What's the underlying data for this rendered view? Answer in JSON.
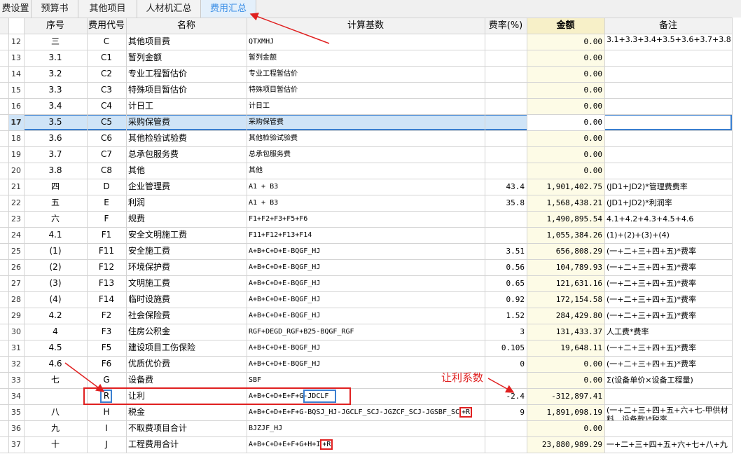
{
  "tabs": [
    {
      "label": "费设置",
      "active": false
    },
    {
      "label": "预算书",
      "active": false
    },
    {
      "label": "其他项目",
      "active": false
    },
    {
      "label": "人材机汇总",
      "active": false
    },
    {
      "label": "费用汇总",
      "active": true
    }
  ],
  "columns": {
    "seq": "序号",
    "code": "费用代号",
    "name": "名称",
    "basis": "计算基数",
    "rate": "费率(%)",
    "amount": "金额",
    "note": "备注"
  },
  "rows": [
    {
      "num": "12",
      "seq": "三",
      "code": "C",
      "name": "其他项目费",
      "basis": "QTXMHJ",
      "rate": "",
      "amount": "0.00",
      "note": "3.1+3.3+3.4+3.5+3.6+3.7+3.8"
    },
    {
      "num": "13",
      "seq": "3.1",
      "code": "C1",
      "name": "暂列金额",
      "basis": "暂列金额",
      "rate": "",
      "amount": "0.00",
      "note": ""
    },
    {
      "num": "14",
      "seq": "3.2",
      "code": "C2",
      "name": "专业工程暂估价",
      "basis": "专业工程暂估价",
      "rate": "",
      "amount": "0.00",
      "note": ""
    },
    {
      "num": "15",
      "seq": "3.3",
      "code": "C3",
      "name": "特殊项目暂估价",
      "basis": "特殊项目暂估价",
      "rate": "",
      "amount": "0.00",
      "note": ""
    },
    {
      "num": "16",
      "seq": "3.4",
      "code": "C4",
      "name": "计日工",
      "basis": "计日工",
      "rate": "",
      "amount": "0.00",
      "note": ""
    },
    {
      "num": "17",
      "seq": "3.5",
      "code": "C5",
      "name": "采购保管费",
      "basis": "采购保管费",
      "rate": "",
      "amount": "0.00",
      "note": ""
    },
    {
      "num": "18",
      "seq": "3.6",
      "code": "C6",
      "name": "其他检验试验费",
      "basis": "其他检验试验费",
      "rate": "",
      "amount": "0.00",
      "note": ""
    },
    {
      "num": "19",
      "seq": "3.7",
      "code": "C7",
      "name": "总承包服务费",
      "basis": "总承包服务费",
      "rate": "",
      "amount": "0.00",
      "note": ""
    },
    {
      "num": "20",
      "seq": "3.8",
      "code": "C8",
      "name": "其他",
      "basis": "其他",
      "rate": "",
      "amount": "0.00",
      "note": ""
    },
    {
      "num": "21",
      "seq": "四",
      "code": "D",
      "name": "企业管理费",
      "basis": "A1 + B3",
      "rate": "43.4",
      "amount": "1,901,402.75",
      "note": "(JD1+JD2)*管理费费率"
    },
    {
      "num": "22",
      "seq": "五",
      "code": "E",
      "name": "利润",
      "basis": "A1 + B3",
      "rate": "35.8",
      "amount": "1,568,438.21",
      "note": "(JD1+JD2)*利润率"
    },
    {
      "num": "23",
      "seq": "六",
      "code": "F",
      "name": "规费",
      "basis": "F1+F2+F3+F5+F6",
      "rate": "",
      "amount": "1,490,895.54",
      "note": "4.1+4.2+4.3+4.5+4.6"
    },
    {
      "num": "24",
      "seq": "4.1",
      "code": "F1",
      "name": "安全文明施工费",
      "basis": "F11+F12+F13+F14",
      "rate": "",
      "amount": "1,055,384.26",
      "note": "(1)+(2)+(3)+(4)"
    },
    {
      "num": "25",
      "seq": "(1)",
      "code": "F11",
      "name": "安全施工费",
      "basis": "A+B+C+D+E-BQGF_HJ",
      "rate": "3.51",
      "amount": "656,808.29",
      "note": "(一+二+三+四+五)*费率"
    },
    {
      "num": "26",
      "seq": "(2)",
      "code": "F12",
      "name": "环境保护费",
      "basis": "A+B+C+D+E-BQGF_HJ",
      "rate": "0.56",
      "amount": "104,789.93",
      "note": "(一+二+三+四+五)*费率"
    },
    {
      "num": "27",
      "seq": "(3)",
      "code": "F13",
      "name": "文明施工费",
      "basis": "A+B+C+D+E-BQGF_HJ",
      "rate": "0.65",
      "amount": "121,631.16",
      "note": "(一+二+三+四+五)*费率"
    },
    {
      "num": "28",
      "seq": "(4)",
      "code": "F14",
      "name": "临时设施费",
      "basis": "A+B+C+D+E-BQGF_HJ",
      "rate": "0.92",
      "amount": "172,154.58",
      "note": "(一+二+三+四+五)*费率"
    },
    {
      "num": "29",
      "seq": "4.2",
      "code": "F2",
      "name": "社会保险费",
      "basis": "A+B+C+D+E-BQGF_HJ",
      "rate": "1.52",
      "amount": "284,429.80",
      "note": "(一+二+三+四+五)*费率"
    },
    {
      "num": "30",
      "seq": "4",
      "code": "F3",
      "name": "住房公积金",
      "basis": "RGF+DEGD_RGF+B25-BQGF_RGF",
      "rate": "3",
      "amount": "131,433.37",
      "note": "人工费*费率"
    },
    {
      "num": "31",
      "seq": "4.5",
      "code": "F5",
      "name": "建设项目工伤保险",
      "basis": "A+B+C+D+E-BQGF_HJ",
      "rate": "0.105",
      "amount": "19,648.11",
      "note": "(一+二+三+四+五)*费率"
    },
    {
      "num": "32",
      "seq": "4.6",
      "code": "F6",
      "name": "优质优价费",
      "basis": "A+B+C+D+E-BQGF_HJ",
      "rate": "0",
      "amount": "0.00",
      "note": "(一+二+三+四+五)*费率"
    },
    {
      "num": "33",
      "seq": "七",
      "code": "G",
      "name": "设备费",
      "basis": "SBF",
      "rate": "",
      "amount": "0.00",
      "note": "Σ(设备单价×设备工程量)"
    },
    {
      "num": "34",
      "seq": "",
      "code": "R",
      "name": "让利",
      "basis": "A+B+C+D+E+F+G-JDCLF",
      "rate": "-2.4",
      "amount": "-312,897.41",
      "note": ""
    },
    {
      "num": "35",
      "seq": "八",
      "code": "H",
      "name": "税金",
      "basis": "A+B+C+D+E+F+G-BQSJ_HJ-JGCLF_SCJ-JGZCF_SCJ-JGSBF_SC",
      "basisTail": "+R",
      "rate": "9",
      "amount": "1,891,098.19",
      "note": "(一+二+三+四+五+六+七-甲供材料、设备款)*税率"
    },
    {
      "num": "36",
      "seq": "九",
      "code": "I",
      "name": "不取费项目合计",
      "basis": "BJZJF_HJ",
      "rate": "",
      "amount": "0.00",
      "note": ""
    },
    {
      "num": "37",
      "seq": "十",
      "code": "J",
      "name": "工程费用合计",
      "basis": "A+B+C+D+E+F+G+H+I",
      "basisTail": "+R",
      "rate": "",
      "amount": "23,880,989.29",
      "note": "一+二+三+四+五+六+七+八+九"
    }
  ],
  "annotation": {
    "label": "让利系数"
  },
  "colors": {
    "accent": "#3a8ee6",
    "annotation": "#e02020",
    "selected_row": "#cfe4f7",
    "amount_column": "#fdfbe6"
  }
}
